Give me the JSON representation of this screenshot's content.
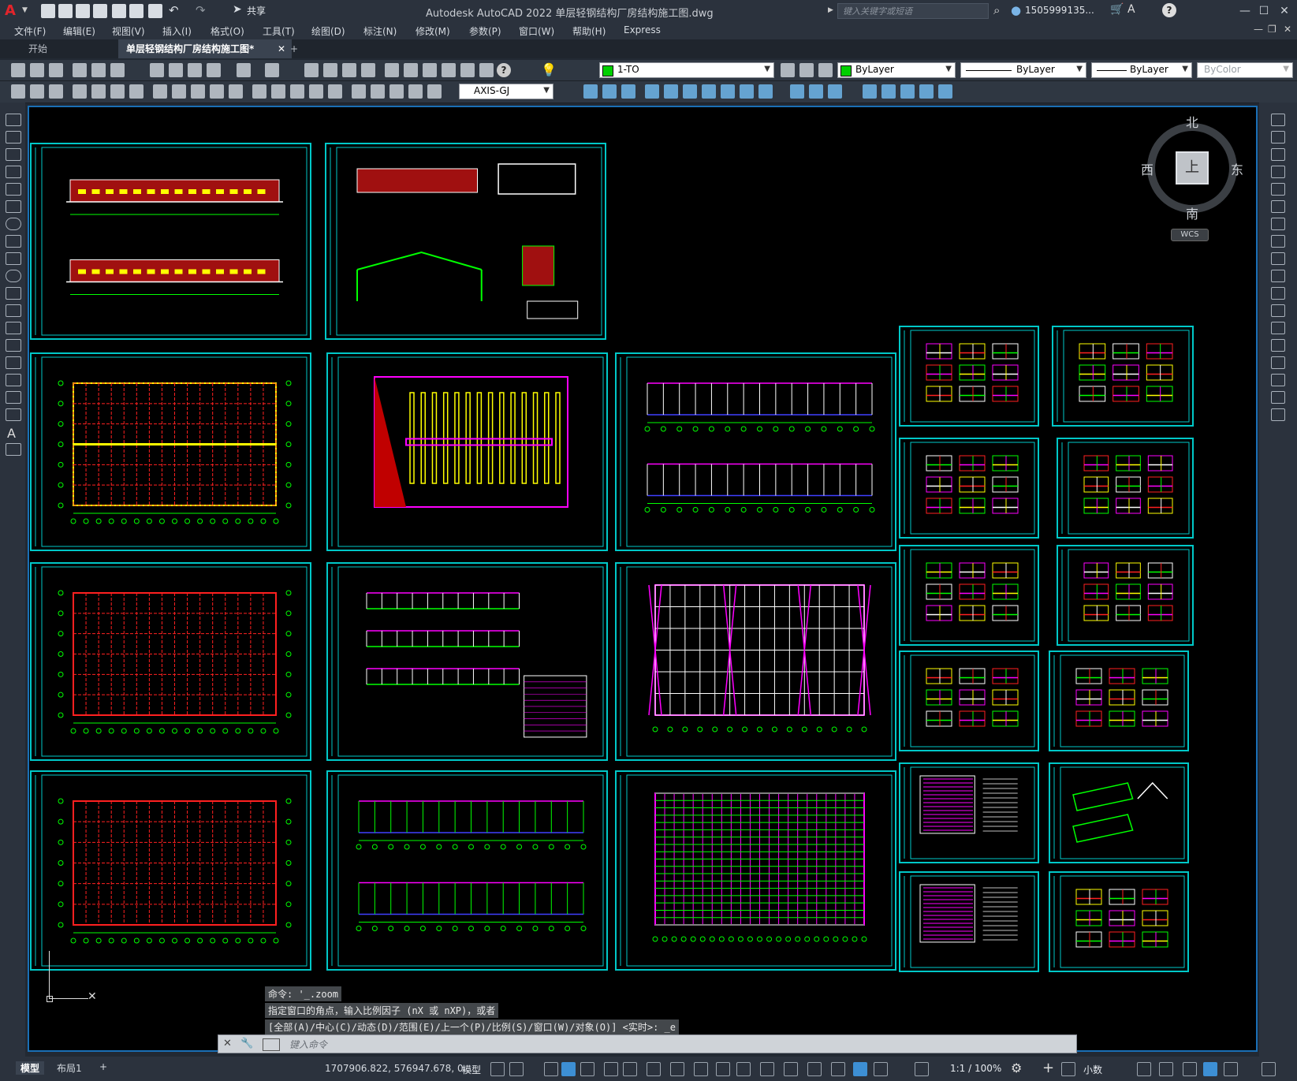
{
  "app": {
    "logo": "A",
    "title": "Autodesk AutoCAD 2022    单层轻钢结构厂房结构施工图.dwg",
    "share": "共享",
    "search_placeholder": "键入关键字或短语",
    "user": "1505999135...",
    "window_controls": [
      "—",
      "☐",
      "✕"
    ]
  },
  "menu": [
    "文件(F)",
    "编辑(E)",
    "视图(V)",
    "插入(I)",
    "格式(O)",
    "工具(T)",
    "绘图(D)",
    "标注(N)",
    "修改(M)",
    "参数(P)",
    "窗口(W)",
    "帮助(H)",
    "Express"
  ],
  "tabs": {
    "start": "开始",
    "document": "单层轻钢结构厂房结构施工图*",
    "close": "✕",
    "add": "+"
  },
  "toolbar": {
    "layer": "1-TO",
    "layer_color": "#00d000",
    "color": "ByLayer",
    "linetype": "ByLayer",
    "lineweight": "ByLayer",
    "plotstyle": "ByColor",
    "dimstyle": "AXIS-GJ"
  },
  "viewcube": {
    "north": "北",
    "south": "南",
    "east": "东",
    "west": "西",
    "top": "上",
    "wcs": "WCS"
  },
  "command": {
    "history": [
      "命令: '_.zoom",
      "指定窗口的角点，输入比例因子 (nX 或 nXP)，或者",
      "[全部(A)/中心(C)/动态(D)/范围(E)/上一个(P)/比例(S)/窗口(W)/对象(O)] <实时>: _e"
    ],
    "placeholder": "键入命令"
  },
  "status": {
    "model_tab": "模型",
    "layout_tab": "布局1",
    "add_tab": "+",
    "coords": "1707906.822, 576947.678, 0....",
    "mode": "模型",
    "scale": "1:1 / 100%",
    "units": "小数"
  },
  "colors": {
    "sheet_border": "#00c8c8",
    "grid_red": "#ff2020",
    "magenta": "#ff00ff",
    "green": "#00ff00",
    "yellow": "#ffff00"
  }
}
